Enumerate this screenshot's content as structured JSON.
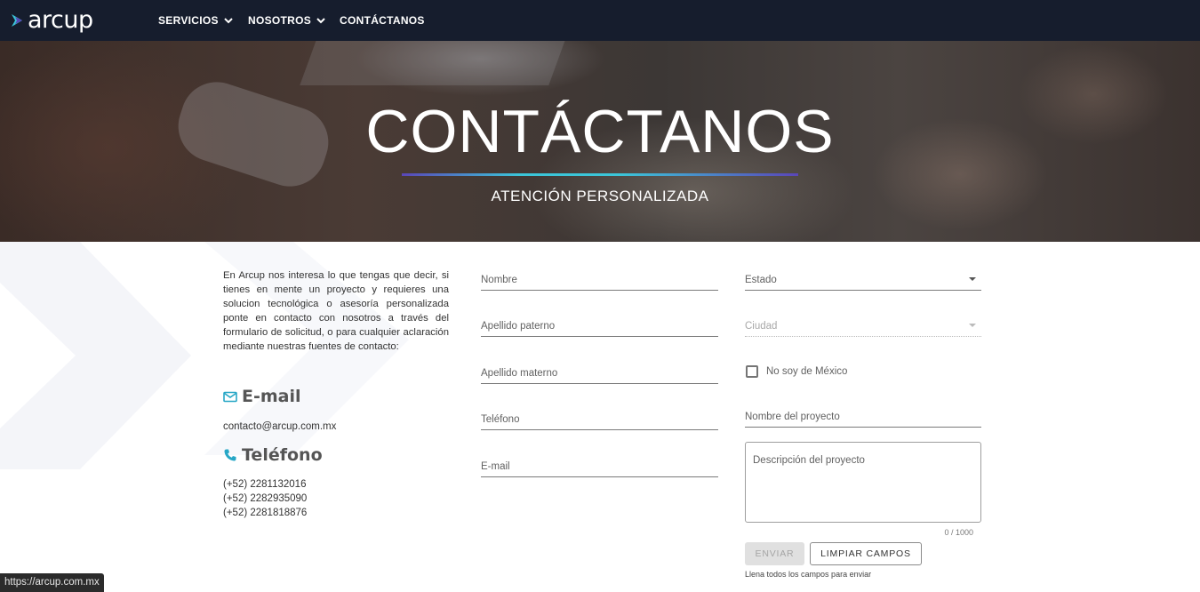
{
  "nav": {
    "logo_text": "arcup",
    "items": [
      {
        "label": "SERVICIOS",
        "has_dropdown": true
      },
      {
        "label": "NOSOTROS",
        "has_dropdown": true
      },
      {
        "label": "CONTÁCTANOS",
        "has_dropdown": false
      }
    ]
  },
  "hero": {
    "title": "CONTÁCTANOS",
    "subtitle": "ATENCIÓN PERSONALIZADA"
  },
  "info": {
    "intro": "En Arcup nos interesa lo que tengas que decir, si tienes en mente un proyecto y requieres una solucion tecnológica o asesoría personalizada ponte en contacto con nosotros a través del formulario de solicitud, o para cualquier aclaración mediante nuestras fuentes de contacto:",
    "email_heading": "E-mail",
    "email": "contacto@arcup.com.mx",
    "phone_heading": "Teléfono",
    "phones": [
      "(+52) 2281132016",
      "(+52) 2282935090",
      "(+52) 2281818876"
    ]
  },
  "form": {
    "nombre": "Nombre",
    "apellido_paterno": "Apellido paterno",
    "apellido_materno": "Apellido materno",
    "telefono": "Teléfono",
    "email": "E-mail",
    "estado": "Estado",
    "ciudad": "Ciudad",
    "no_mexico": "No soy de México",
    "nombre_proyecto": "Nombre del proyecto",
    "descripcion": "Descripción del proyecto",
    "counter": "0 / 1000",
    "send_label": "ENVIAR",
    "clear_label": "LIMPIAR CAMPOS",
    "hint": "Llena todos los campos para enviar"
  },
  "status_bar": {
    "url": "https://arcup.com.mx"
  },
  "colors": {
    "nav_bg": "#161d2d",
    "accent_cyan": "#3bc6d9",
    "accent_purple": "#5a46b8"
  }
}
